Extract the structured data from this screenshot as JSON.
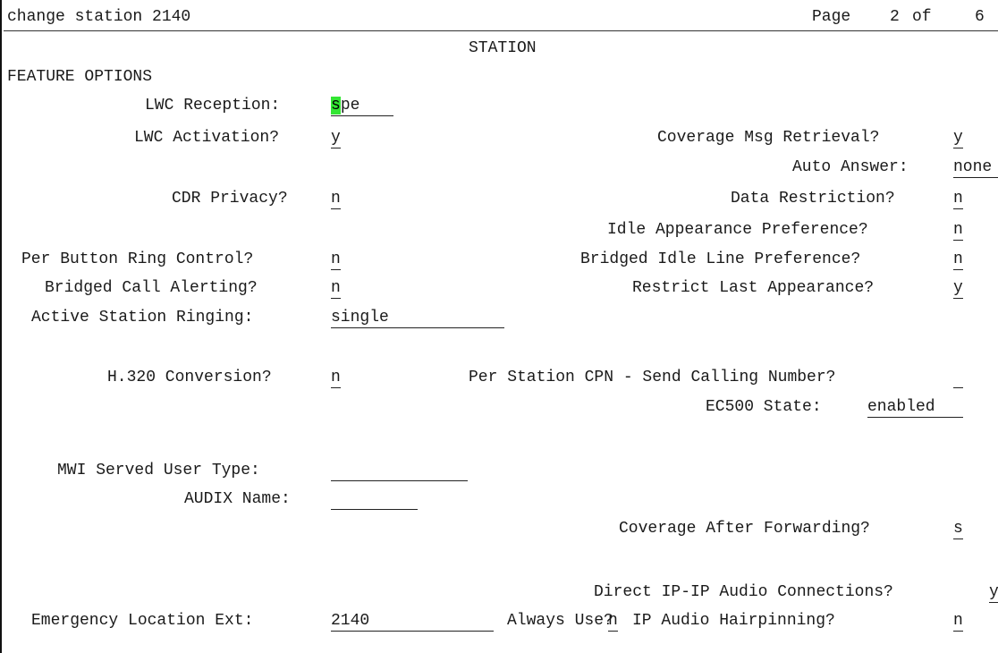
{
  "header": {
    "command": "change station 2140",
    "page_label": "Page",
    "page_current": "2",
    "page_of": "of",
    "page_total": "6"
  },
  "title": "STATION",
  "section": "FEATURE OPTIONS",
  "left": {
    "lwc_reception": {
      "label": "LWC Reception:",
      "cursor_char": "s",
      "rest": "pe"
    },
    "lwc_activation": {
      "label": "LWC Activation?",
      "value": "y"
    },
    "cdr_privacy": {
      "label": "CDR Privacy?",
      "value": "n"
    },
    "per_button_ring": {
      "label": "Per Button Ring Control?",
      "value": "n"
    },
    "bridged_call_alerting": {
      "label": "Bridged Call Alerting?",
      "value": "n"
    },
    "active_station_ringing": {
      "label": "Active Station Ringing:",
      "value": "single"
    },
    "h320": {
      "label": "H.320 Conversion?",
      "value": "n"
    },
    "mwi_served": {
      "label": "MWI Served User Type:",
      "value": ""
    },
    "audix_name": {
      "label": "AUDIX Name:",
      "value": ""
    },
    "emergency_ext": {
      "label": "Emergency Location Ext:",
      "value": "2140"
    }
  },
  "right": {
    "coverage_msg": {
      "label": "Coverage Msg Retrieval?",
      "value": "y"
    },
    "auto_answer": {
      "label": "Auto Answer:",
      "value": "none"
    },
    "data_restriction": {
      "label": "Data Restriction?",
      "value": "n"
    },
    "idle_appearance": {
      "label": "Idle Appearance Preference?",
      "value": "n"
    },
    "bridged_idle": {
      "label": "Bridged Idle Line Preference?",
      "value": "n"
    },
    "restrict_last": {
      "label": "Restrict Last Appearance?",
      "value": "y"
    },
    "per_station_cpn": {
      "label": "Per Station CPN - Send Calling Number?",
      "value": ""
    },
    "ec500": {
      "label": "EC500 State:",
      "value": "enabled"
    },
    "coverage_after_fwd": {
      "label": "Coverage After Forwarding?",
      "value": "s"
    },
    "direct_ip": {
      "label": "Direct IP-IP Audio Connections?",
      "value": "y"
    },
    "always_use": {
      "label": "Always Use?",
      "value": "n"
    },
    "ip_hairpin": {
      "label": "IP Audio Hairpinning?",
      "value": "n"
    }
  }
}
